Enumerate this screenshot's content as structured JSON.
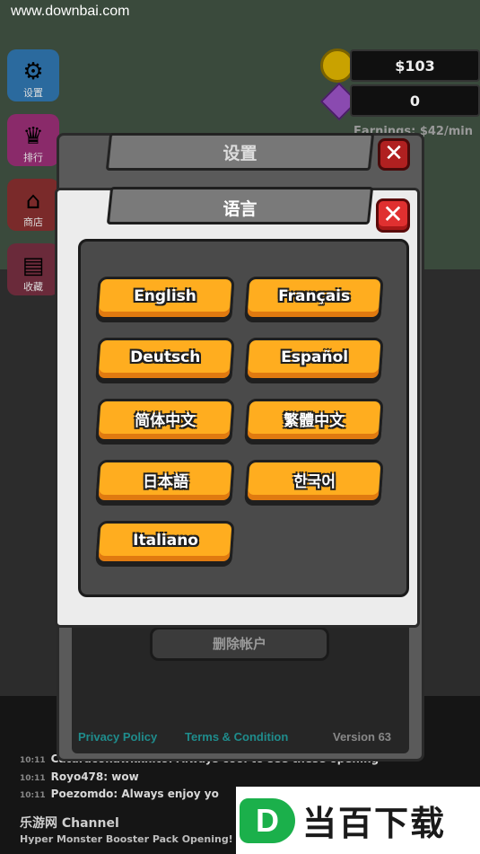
{
  "watermark_top": "www.downbai.com",
  "sidebar": {
    "items": [
      {
        "label": "设置",
        "icon": "gear-icon"
      },
      {
        "label": "排行",
        "icon": "crown-icon"
      },
      {
        "label": "商店",
        "icon": "shop-icon"
      },
      {
        "label": "收藏",
        "icon": "collection-icon"
      }
    ]
  },
  "currency": {
    "money": "$103",
    "gems": "0",
    "earnings": "Earnings: $42/min"
  },
  "settings": {
    "title": "设置",
    "delete_account": "删除帐户",
    "privacy_policy": "Privacy Policy",
    "terms": "Terms & Condition",
    "version": "Version 63"
  },
  "language_dialog": {
    "title": "语言",
    "close": "✕",
    "languages": [
      "English",
      "Français",
      "Deutsch",
      "Español",
      "简体中文",
      "繁體中文",
      "日本語",
      "한국어",
      "Italiano"
    ]
  },
  "chat": {
    "lines": [
      {
        "time": "10:11",
        "text": "Catdraconawkknito: Always cool to see these opening"
      },
      {
        "time": "10:11",
        "text": "Royo478: wow"
      },
      {
        "time": "10:11",
        "text": "Poezomdo: Always enjoy yo"
      }
    ],
    "channel": "乐游网 Channel",
    "channel_sub": "Hyper Monster Booster Pack Opening!"
  },
  "logo": {
    "mark": "D",
    "text": "当百下载"
  },
  "colors": {
    "button_orange": "#ffad1f",
    "close_red": "#e03030",
    "link_teal": "#1f8c8c"
  }
}
